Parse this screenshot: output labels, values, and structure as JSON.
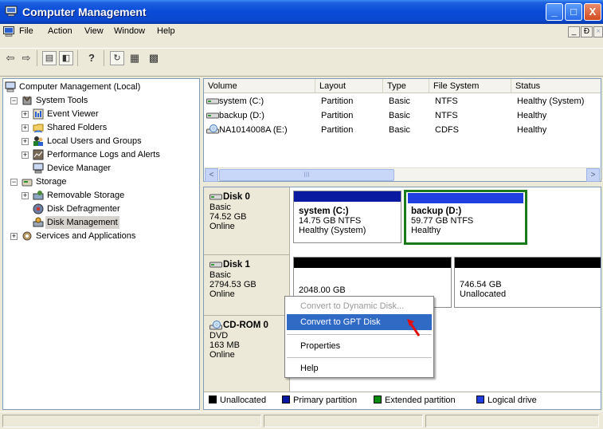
{
  "window": {
    "title": "Computer Management",
    "controls": {
      "minimize": "_",
      "maximize": "□",
      "close": "X"
    }
  },
  "menu": {
    "items": [
      "File",
      "Action",
      "View",
      "Window",
      "Help"
    ],
    "mdi_controls": [
      "_",
      "Ɖ",
      "×"
    ]
  },
  "toolbar": {
    "icons": [
      "back-arrow-icon",
      "forward-arrow-icon",
      "up-folder-icon",
      "show-hide-tree-icon",
      "help-icon",
      "refresh-icon",
      "properties-icon",
      "export-list-icon"
    ]
  },
  "tree": {
    "root": "Computer Management (Local)",
    "system_tools": "System Tools",
    "event_viewer": "Event Viewer",
    "shared_folders": "Shared Folders",
    "local_users": "Local Users and Groups",
    "perf_logs": "Performance Logs and Alerts",
    "device_manager": "Device Manager",
    "storage": "Storage",
    "removable_storage": "Removable Storage",
    "disk_defrag": "Disk Defragmenter",
    "disk_management": "Disk Management",
    "services": "Services and Applications"
  },
  "volumes": {
    "headers": [
      "Volume",
      "Layout",
      "Type",
      "File System",
      "Status"
    ],
    "rows": [
      [
        "system (C:)",
        "Partition",
        "Basic",
        "NTFS",
        "Healthy (System)"
      ],
      [
        "backup (D:)",
        "Partition",
        "Basic",
        "NTFS",
        "Healthy"
      ],
      [
        "NA1014008A (E:)",
        "Partition",
        "Basic",
        "CDFS",
        "Healthy"
      ]
    ],
    "scroll_left": "<",
    "scroll_right": ">",
    "scroll_thumb": "III"
  },
  "disks": [
    {
      "name": "Disk 0",
      "kind": "Basic",
      "size": "74.52 GB",
      "status": "Online"
    },
    {
      "name": "Disk 1",
      "kind": "Basic",
      "size": "2794.53 GB",
      "status": "Online"
    },
    {
      "name": "CD-ROM 0",
      "kind": "DVD",
      "size": "163 MB",
      "status": "Online"
    }
  ],
  "partitions": {
    "system": {
      "title": "system (C:)",
      "size": "14.75 GB NTFS",
      "status": "Healthy (System)"
    },
    "backup": {
      "title": "backup (D:)",
      "size": "59.77 GB NTFS",
      "status": "Healthy"
    },
    "disk1_left": {
      "size": "2048.00 GB"
    },
    "disk1_right": {
      "size": "746.54 GB",
      "status": "Unallocated"
    }
  },
  "legend": [
    "Unallocated",
    "Primary partition",
    "Extended partition",
    "Logical drive"
  ],
  "colors": {
    "unallocated": "#000000",
    "primary": "#0a1aa0",
    "extended": "#0a8a0a",
    "logical": "#1f3fe0",
    "selection": "#316ac5",
    "title_bar": "#0a4ad6"
  },
  "context_menu": {
    "items": [
      {
        "label": "Convert to Dynamic Disk...",
        "state": "disabled"
      },
      {
        "label": "Convert to GPT Disk",
        "state": "highlighted"
      },
      {
        "label": "Properties",
        "state": "normal"
      },
      {
        "label": "Help",
        "state": "normal"
      }
    ]
  }
}
